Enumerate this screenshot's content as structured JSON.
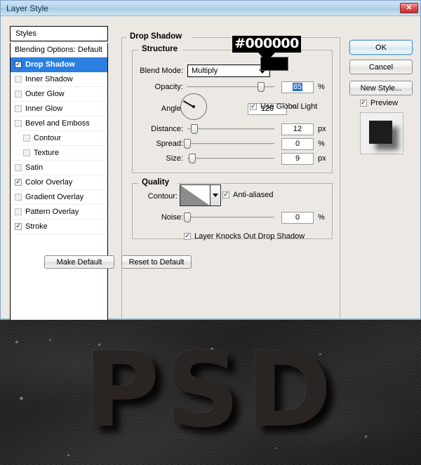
{
  "window": {
    "title": "Layer Style",
    "close_label": "✕"
  },
  "styles_panel": {
    "header": "Styles",
    "items": [
      {
        "label": "Blending Options: Default",
        "checkbox": false,
        "has_checkbox": false,
        "selected": false,
        "nested": false
      },
      {
        "label": "Drop Shadow",
        "checkbox": true,
        "has_checkbox": true,
        "selected": true,
        "nested": false
      },
      {
        "label": "Inner Shadow",
        "checkbox": false,
        "has_checkbox": true,
        "selected": false,
        "nested": false
      },
      {
        "label": "Outer Glow",
        "checkbox": false,
        "has_checkbox": true,
        "selected": false,
        "nested": false
      },
      {
        "label": "Inner Glow",
        "checkbox": false,
        "has_checkbox": true,
        "selected": false,
        "nested": false
      },
      {
        "label": "Bevel and Emboss",
        "checkbox": false,
        "has_checkbox": true,
        "selected": false,
        "nested": false
      },
      {
        "label": "Contour",
        "checkbox": false,
        "has_checkbox": true,
        "selected": false,
        "nested": true
      },
      {
        "label": "Texture",
        "checkbox": false,
        "has_checkbox": true,
        "selected": false,
        "nested": true
      },
      {
        "label": "Satin",
        "checkbox": false,
        "has_checkbox": true,
        "selected": false,
        "nested": false
      },
      {
        "label": "Color Overlay",
        "checkbox": true,
        "has_checkbox": true,
        "selected": false,
        "nested": false
      },
      {
        "label": "Gradient Overlay",
        "checkbox": false,
        "has_checkbox": true,
        "selected": false,
        "nested": false
      },
      {
        "label": "Pattern Overlay",
        "checkbox": false,
        "has_checkbox": true,
        "selected": false,
        "nested": false
      },
      {
        "label": "Stroke",
        "checkbox": true,
        "has_checkbox": true,
        "selected": false,
        "nested": false
      }
    ]
  },
  "drop_shadow": {
    "group_title": "Drop Shadow",
    "structure": {
      "title": "Structure",
      "blend_mode_label": "Blend Mode:",
      "blend_mode_value": "Multiply",
      "shadow_color": "#000000",
      "callout_text": "#000000",
      "opacity_label": "Opacity:",
      "opacity_value": "85",
      "opacity_unit": "%",
      "angle_label": "Angle:",
      "angle_value": "120",
      "angle_unit": "°",
      "use_global_light_label": "Use Global Light",
      "use_global_light_checked": true,
      "distance_label": "Distance:",
      "distance_value": "12",
      "distance_unit": "px",
      "spread_label": "Spread:",
      "spread_value": "0",
      "spread_unit": "%",
      "size_label": "Size:",
      "size_value": "9",
      "size_unit": "px"
    },
    "quality": {
      "title": "Quality",
      "contour_label": "Contour:",
      "anti_aliased_label": "Anti-aliased",
      "anti_aliased_checked": true,
      "noise_label": "Noise:",
      "noise_value": "0",
      "noise_unit": "%"
    },
    "knockout_label": "Layer Knocks Out Drop Shadow",
    "knockout_checked": true,
    "make_default_label": "Make Default",
    "reset_default_label": "Reset to Default"
  },
  "actions": {
    "ok_label": "OK",
    "cancel_label": "Cancel",
    "new_style_label": "New Style...",
    "preview_label": "Preview",
    "preview_checked": true
  },
  "artwork": {
    "text": "PSD"
  },
  "colors": {
    "selection_blue": "#2a7fe0",
    "title_blue": "#b8d6ec",
    "shadow_color": "#000000",
    "close_red": "#c13636"
  }
}
